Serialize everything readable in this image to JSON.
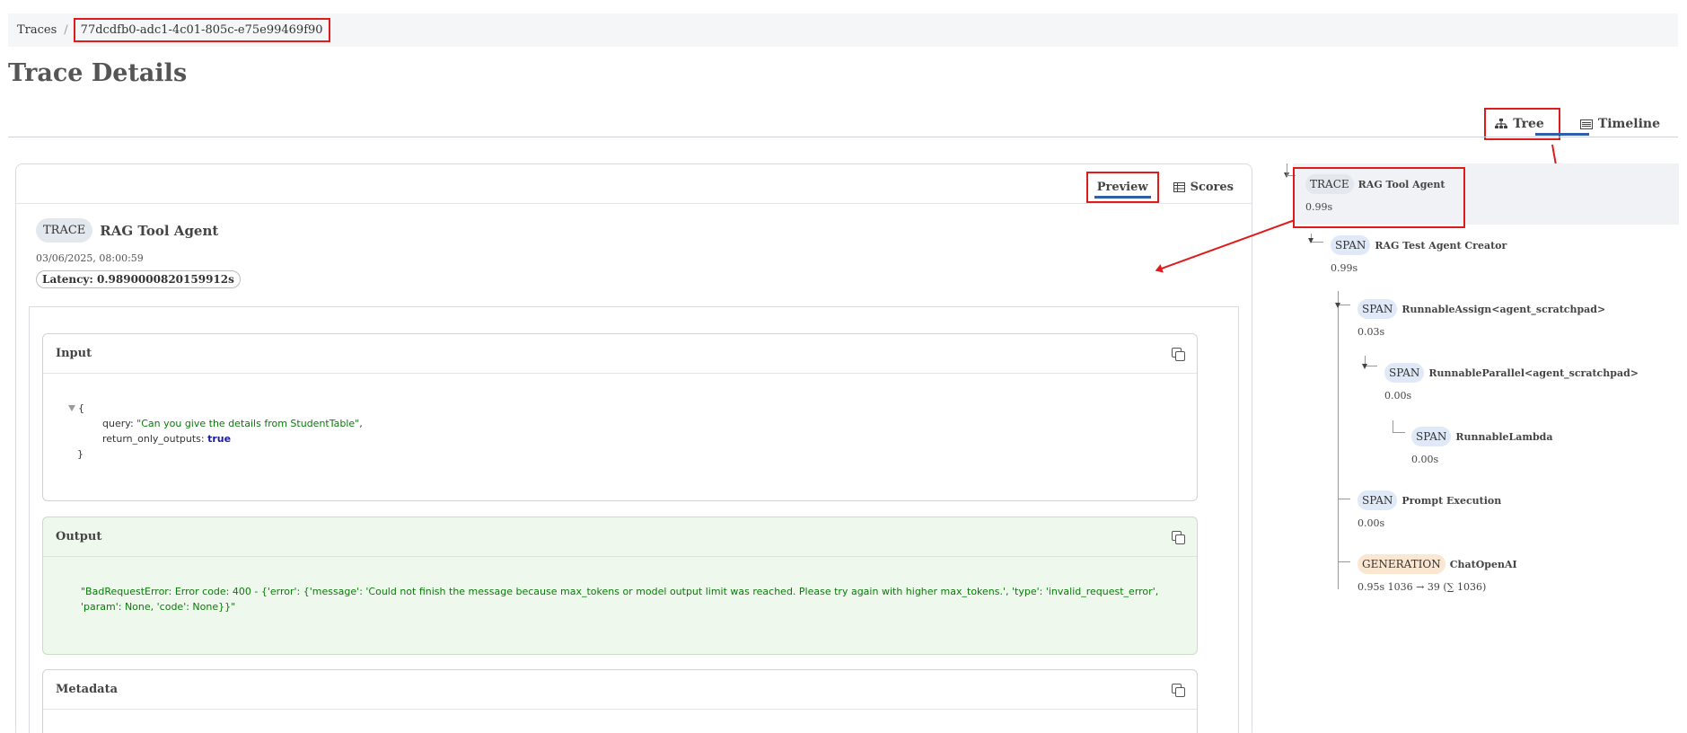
{
  "breadcrumb": {
    "root": "Traces",
    "separator": "/",
    "trace_id": "77dcdfb0-adc1-4c01-805c-e75e99469f90"
  },
  "page_title": "Trace Details",
  "view_tabs": {
    "tree_label": "Tree",
    "timeline_label": "Timeline",
    "active": "Tree"
  },
  "card_tabs": {
    "preview_label": "Preview",
    "scores_label": "Scores",
    "active": "Preview"
  },
  "trace_header": {
    "type": "TRACE",
    "name": "RAG Tool Agent",
    "timestamp": "03/06/2025, 08:00:59",
    "latency": "Latency: 0.9890000820159912s"
  },
  "input": {
    "title": "Input",
    "open_brace": "{",
    "close_brace": "}",
    "fields": [
      {
        "key": "query",
        "value": "\"Can you give the details from StudentTable\"",
        "suffix": ",",
        "kind": "str"
      },
      {
        "key": "return_only_outputs",
        "value": "true",
        "suffix": "",
        "kind": "bool"
      }
    ]
  },
  "output": {
    "title": "Output",
    "text": "\"BadRequestError: Error code: 400 - {'error': {'message': 'Could not finish the message because max_tokens or model output limit was reached. Please try again with higher max_tokens.', 'type': 'invalid_request_error', 'param': None, 'code': None}}\""
  },
  "metadata": {
    "title": "Metadata"
  },
  "tree": [
    {
      "type": "TRACE",
      "name": "RAG Tool Agent",
      "duration": "0.99s"
    },
    {
      "type": "SPAN",
      "name": "RAG Test Agent Creator",
      "duration": "0.99s"
    },
    {
      "type": "SPAN",
      "name": "RunnableAssign<agent_scratchpad>",
      "duration": "0.03s"
    },
    {
      "type": "SPAN",
      "name": "RunnableParallel<agent_scratchpad>",
      "duration": "0.00s"
    },
    {
      "type": "SPAN",
      "name": "RunnableLambda",
      "duration": "0.00s"
    },
    {
      "type": "SPAN",
      "name": "Prompt Execution",
      "duration": "0.00s"
    },
    {
      "type": "GENERATION",
      "name": "ChatOpenAI",
      "duration": "0.95s 1036 → 39 (∑ 1036)"
    }
  ],
  "colors": {
    "annotation": "#e01b1b",
    "tab_underline": "#2e5fa8",
    "output_bg": "#eef8ec",
    "string_value": "#0a7a0a",
    "bool_value": "#1a1aa6"
  }
}
